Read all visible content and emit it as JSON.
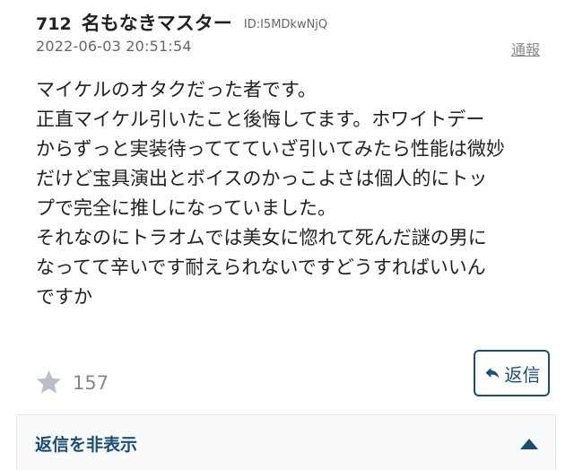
{
  "post": {
    "number": "712",
    "name": "名もなきマスター",
    "user_id": "ID:I5MDkwNjQ",
    "date": "2022-06-03 20:51:54",
    "report_label": "通報",
    "body_lines": [
      "マイケルのオタクだった者です。",
      "正直マイケル引いたこと後悔してます。ホワイトデー",
      "からずっと実装待っててていざ引いてみたら性能は微妙",
      "だけど宝具演出とボイスのかっこよさは個人的にトッ",
      "プで完全に推しになっていました。",
      "それなのにトラオムでは美女に惚れて死んだ謎の男に",
      "なってて辛いです耐えられないですどうすればいいん",
      "ですか"
    ],
    "like_icon": "star-icon",
    "like_count": "157",
    "reply_icon": "reply-arrow-icon",
    "reply_label": "返信",
    "hide_replies_label": "返信を非表示",
    "collapse_icon": "caret-up-icon"
  },
  "colors": {
    "accent": "#1d4e72",
    "muted_text": "#888888",
    "star": "#b8bfc8",
    "toggle_bg": "#f8fafc"
  }
}
